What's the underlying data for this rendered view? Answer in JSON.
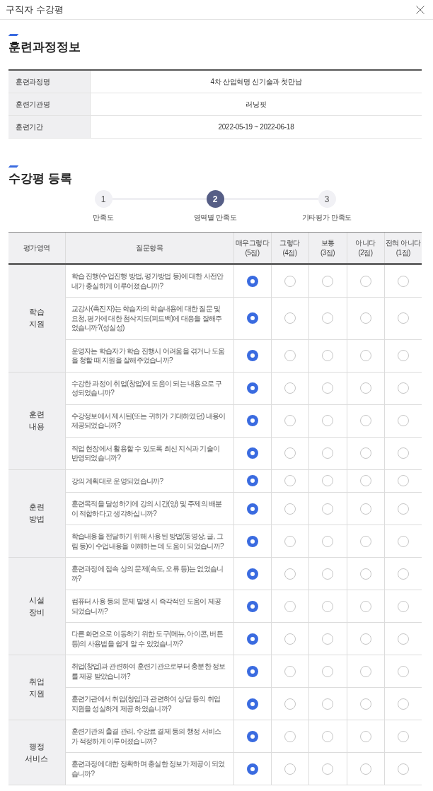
{
  "window": {
    "title": "구직자 수강평"
  },
  "course_info": {
    "title": "훈련과정정보",
    "rows": [
      {
        "label": "훈련과정명",
        "value": "4차 산업혁명 신기술과 첫만남"
      },
      {
        "label": "훈련기관명",
        "value": "러닝핏"
      },
      {
        "label": "훈련기간",
        "value": "2022-05-19 ~ 2022-06-18"
      }
    ]
  },
  "evaluation": {
    "title": "수강평 등록",
    "steps": [
      {
        "number": "1",
        "label": "만족도",
        "selected": false
      },
      {
        "number": "2",
        "label": "영역별 만족도",
        "selected": true
      },
      {
        "number": "3",
        "label": "기타평가 만족도",
        "selected": false
      }
    ],
    "table": {
      "columns": [
        "평가영역",
        "질문항목",
        "매우그렇다\n(5점)",
        "그렇다\n(4점)",
        "보통\n(3점)",
        "아니다\n(2점)",
        "전혀 아니다\n(1점)"
      ],
      "groups": [
        {
          "area": "학습\n지원",
          "questions": [
            {
              "text": "학습 진행(수업진행 방법, 평가방법 등)에 대한 사전안내가 충실하게 이루어졌습니까?",
              "options": [
                {
                  "selected": true
                },
                {
                  "selected": false
                },
                {
                  "selected": false
                },
                {
                  "selected": false
                },
                {
                  "selected": false
                }
              ]
            },
            {
              "text": "교강사(촉진자)는 학습자의 학습내용에 대한 질문 및 요청, 평가에 대한 첨삭지도(피드백)에 대응을 잘해주었습니까?(성실성)",
              "options": [
                {
                  "selected": true
                },
                {
                  "selected": false
                },
                {
                  "selected": false
                },
                {
                  "selected": false
                },
                {
                  "selected": false
                }
              ]
            },
            {
              "text": "운영자는 학습자가 학습 진행시 어려움을 겪거나 도움을 청할 때 지원을 잘해주었습니까?",
              "options": [
                {
                  "selected": true
                },
                {
                  "selected": false
                },
                {
                  "selected": false
                },
                {
                  "selected": false
                },
                {
                  "selected": false
                }
              ]
            }
          ]
        },
        {
          "area": "훈련\n내용",
          "questions": [
            {
              "text": "수강한 과정이 취업(창업)에 도움이 되는 내용으로 구성되었습니까?",
              "options": [
                {
                  "selected": true
                },
                {
                  "selected": false
                },
                {
                  "selected": false
                },
                {
                  "selected": false
                },
                {
                  "selected": false
                }
              ]
            },
            {
              "text": "수강정보에서 제시된(또는 귀하가 기대하였던) 내용이 제공되었습니까?",
              "options": [
                {
                  "selected": true
                },
                {
                  "selected": false
                },
                {
                  "selected": false
                },
                {
                  "selected": false
                },
                {
                  "selected": false
                }
              ]
            },
            {
              "text": "직업 현장에서 활용할 수 있도록 최신 지식과 기술이 반영되었습니까?",
              "options": [
                {
                  "selected": true
                },
                {
                  "selected": false
                },
                {
                  "selected": false
                },
                {
                  "selected": false
                },
                {
                  "selected": false
                }
              ]
            }
          ]
        },
        {
          "area": "훈련\n방법",
          "questions": [
            {
              "text": "강의 계획대로 운영되었습니까?",
              "options": [
                {
                  "selected": true
                },
                {
                  "selected": false
                },
                {
                  "selected": false
                },
                {
                  "selected": false
                },
                {
                  "selected": false
                }
              ]
            },
            {
              "text": "훈련목적을 달성하기에 강의 시간(양) 및 주제의 배분이 적합하다고 생각하십니까?",
              "options": [
                {
                  "selected": true
                },
                {
                  "selected": false
                },
                {
                  "selected": false
                },
                {
                  "selected": false
                },
                {
                  "selected": false
                }
              ]
            },
            {
              "text": "학습내용을 전달하기 위해 사용된 방법(동영상, 글, 그림 등)이 수업내용을 이해하는 데 도움이 되었습니까?",
              "options": [
                {
                  "selected": true
                },
                {
                  "selected": false
                },
                {
                  "selected": false
                },
                {
                  "selected": false
                },
                {
                  "selected": false
                }
              ]
            }
          ]
        },
        {
          "area": "시설\n장비",
          "questions": [
            {
              "text": "훈련과정에 접속 상의 문제(속도, 오류 등)는 없었습니까?",
              "options": [
                {
                  "selected": true
                },
                {
                  "selected": false
                },
                {
                  "selected": false
                },
                {
                  "selected": false
                },
                {
                  "selected": false
                }
              ]
            },
            {
              "text": "컴퓨터 사용 등의 문제 발생 시 즉각적인 도움이 제공 되었습니까?",
              "options": [
                {
                  "selected": true
                },
                {
                  "selected": false
                },
                {
                  "selected": false
                },
                {
                  "selected": false
                },
                {
                  "selected": false
                }
              ]
            },
            {
              "text": "다른 화면으로 이동하기 위한 도구(메뉴, 아이콘, 버튼 등)의 사용법을 쉽게 알 수 있었습니까?",
              "options": [
                {
                  "selected": true
                },
                {
                  "selected": false
                },
                {
                  "selected": false
                },
                {
                  "selected": false
                },
                {
                  "selected": false
                }
              ]
            }
          ]
        },
        {
          "area": "취업\n지원",
          "questions": [
            {
              "text": "취업(창업)과 관련하여 훈련기관으로부터 충분한 정보를 제공 받았습니까?",
              "options": [
                {
                  "selected": true
                },
                {
                  "selected": false
                },
                {
                  "selected": false
                },
                {
                  "selected": false
                },
                {
                  "selected": false
                }
              ]
            },
            {
              "text": "훈련기관에서 취업(창업)과 관련하여 상담 등의 취업 지원을 성실하게 제공 하였습니까?",
              "options": [
                {
                  "selected": true
                },
                {
                  "selected": false
                },
                {
                  "selected": false
                },
                {
                  "selected": false
                },
                {
                  "selected": false
                }
              ]
            }
          ]
        },
        {
          "area": "행정\n서비스",
          "questions": [
            {
              "text": "훈련기관의 출결 관리, 수강료 결제 등의 행정 서비스가 적정하게 이루어졌습니까?",
              "options": [
                {
                  "selected": true
                },
                {
                  "selected": false
                },
                {
                  "selected": false
                },
                {
                  "selected": false
                },
                {
                  "selected": false
                }
              ]
            },
            {
              "text": "훈련과정에 대한 정확하며 충실한 정보가 제공이 되었습니까?",
              "options": [
                {
                  "selected": true
                },
                {
                  "selected": false
                },
                {
                  "selected": false
                },
                {
                  "selected": false
                },
                {
                  "selected": false
                }
              ]
            }
          ]
        }
      ]
    }
  }
}
